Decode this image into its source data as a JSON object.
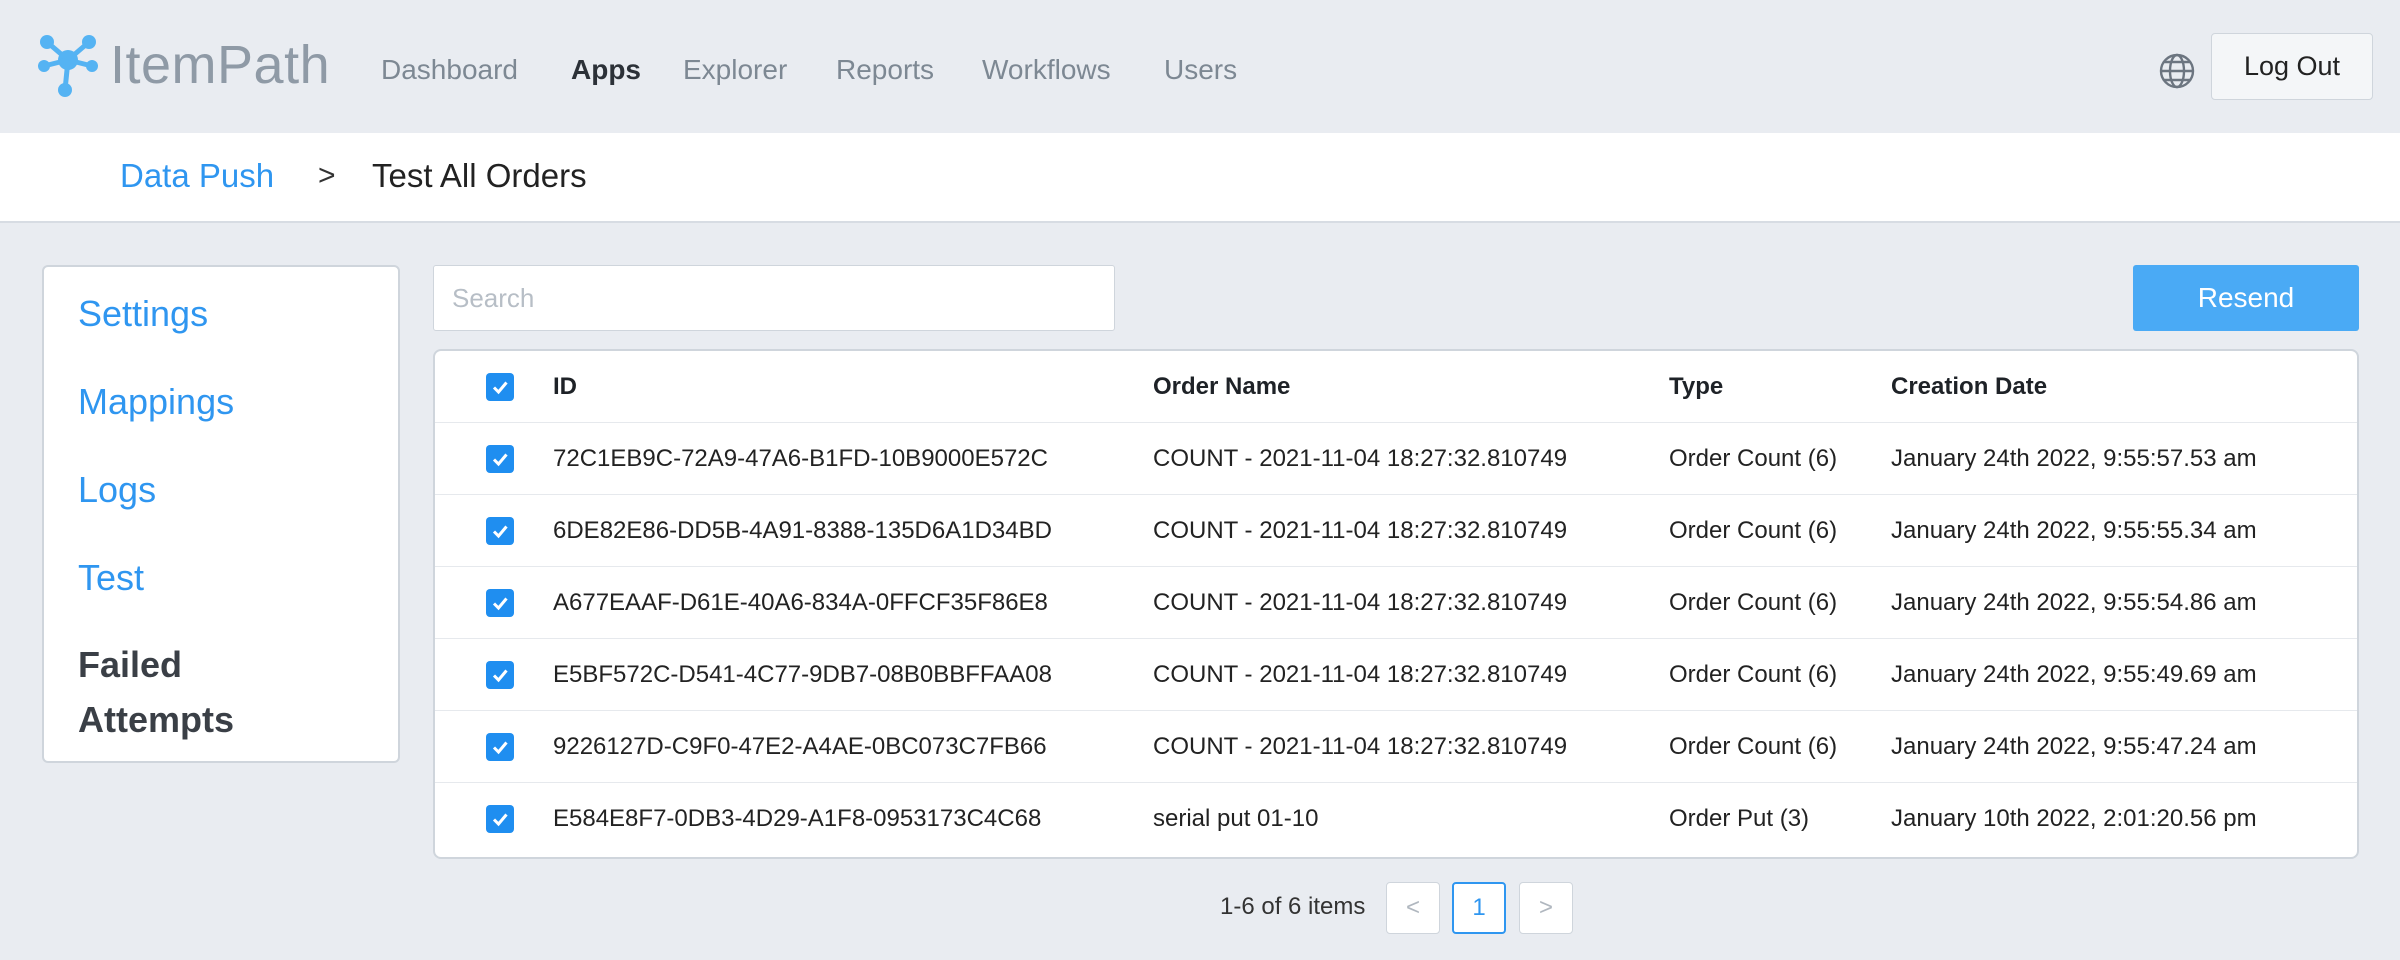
{
  "app": {
    "name": "ItemPath"
  },
  "nav": {
    "items": [
      {
        "label": "Dashboard",
        "active": false
      },
      {
        "label": "Apps",
        "active": true
      },
      {
        "label": "Explorer",
        "active": false
      },
      {
        "label": "Reports",
        "active": false
      },
      {
        "label": "Workflows",
        "active": false
      },
      {
        "label": "Users",
        "active": false
      }
    ],
    "language_icon": "globe-icon",
    "logout_label": "Log Out"
  },
  "breadcrumb": {
    "parent": "Data Push",
    "separator": ">",
    "current": "Test All Orders"
  },
  "sidebar": {
    "items": [
      {
        "label": "Settings",
        "active": false
      },
      {
        "label": "Mappings",
        "active": false
      },
      {
        "label": "Logs",
        "active": false
      },
      {
        "label": "Test",
        "active": false
      },
      {
        "label": "Failed Attempts",
        "active": true
      }
    ]
  },
  "toolbar": {
    "search_placeholder": "Search",
    "search_value": "",
    "resend_label": "Resend"
  },
  "table": {
    "columns": [
      "ID",
      "Order Name",
      "Type",
      "Creation Date"
    ],
    "select_all_checked": true,
    "rows": [
      {
        "checked": true,
        "id": "72C1EB9C-72A9-47A6-B1FD-10B9000E572C",
        "order_name": "COUNT - 2021-11-04 18:27:32.810749",
        "type": "Order Count (6)",
        "creation_date": "January 24th 2022, 9:55:57.53 am"
      },
      {
        "checked": true,
        "id": "6DE82E86-DD5B-4A91-8388-135D6A1D34BD",
        "order_name": "COUNT - 2021-11-04 18:27:32.810749",
        "type": "Order Count (6)",
        "creation_date": "January 24th 2022, 9:55:55.34 am"
      },
      {
        "checked": true,
        "id": "A677EAAF-D61E-40A6-834A-0FFCF35F86E8",
        "order_name": "COUNT - 2021-11-04 18:27:32.810749",
        "type": "Order Count (6)",
        "creation_date": "January 24th 2022, 9:55:54.86 am"
      },
      {
        "checked": true,
        "id": "E5BF572C-D541-4C77-9DB7-08B0BBFFAA08",
        "order_name": "COUNT - 2021-11-04 18:27:32.810749",
        "type": "Order Count (6)",
        "creation_date": "January 24th 2022, 9:55:49.69 am"
      },
      {
        "checked": true,
        "id": "9226127D-C9F0-47E2-A4AE-0BC073C7FB66",
        "order_name": "COUNT - 2021-11-04 18:27:32.810749",
        "type": "Order Count (6)",
        "creation_date": "January 24th 2022, 9:55:47.24 am"
      },
      {
        "checked": true,
        "id": "E584E8F7-0DB3-4D29-A1F8-0953173C4C68",
        "order_name": "serial put 01-10",
        "type": "Order Put (3)",
        "creation_date": "January 10th 2022, 2:01:20.56 pm"
      }
    ]
  },
  "pagination": {
    "summary": "1-6 of 6 items",
    "prev_glyph": "<",
    "current_page": "1",
    "next_glyph": ">"
  },
  "colors": {
    "accent": "#2f96f0",
    "button": "#4aaaf5",
    "checkbox": "#1f8ef0",
    "background": "#e9ecf1"
  }
}
